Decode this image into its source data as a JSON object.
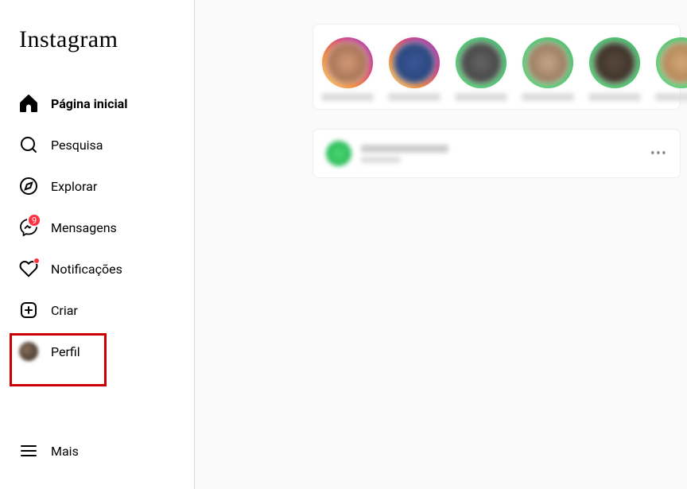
{
  "brand": "Instagram",
  "sidebar": {
    "items": [
      {
        "label": "Página inicial",
        "icon": "home-icon",
        "active": true
      },
      {
        "label": "Pesquisa",
        "icon": "search-icon"
      },
      {
        "label": "Explorar",
        "icon": "compass-icon"
      },
      {
        "label": "Mensagens",
        "icon": "messenger-icon",
        "badge": "9"
      },
      {
        "label": "Notificações",
        "icon": "heart-icon",
        "dot": true
      },
      {
        "label": "Criar",
        "icon": "plus-square-icon",
        "highlighted": true
      },
      {
        "label": "Perfil",
        "icon": "profile-avatar"
      }
    ],
    "more_label": "Mais"
  },
  "stories": {
    "items": [
      {
        "ring_gradient": "linear-gradient(45deg,#feda75,#fa7e1e,#d62976,#962fbf)",
        "bg": "radial-gradient(circle,#d49b7a,#8b5a3c)"
      },
      {
        "ring_gradient": "linear-gradient(45deg,#feda75,#fa7e1e,#d62976,#962fbf)",
        "bg": "radial-gradient(circle,#3b5998,#1e3a6e)"
      },
      {
        "ring_gradient": "linear-gradient(45deg,#4dd471,#2dbd5d)",
        "bg": "radial-gradient(circle,#666,#333)"
      },
      {
        "ring_gradient": "linear-gradient(45deg,#4dd471,#2dbd5d)",
        "bg": "radial-gradient(circle,#c9a888,#7d6148)"
      },
      {
        "ring_gradient": "linear-gradient(45deg,#4dd471,#2dbd5d)",
        "bg": "radial-gradient(circle,#5a4a3d,#2e251e)"
      },
      {
        "ring_gradient": "linear-gradient(45deg,#4dd471,#2dbd5d)",
        "bg": "radial-gradient(circle,#d4a878,#a07548)"
      }
    ]
  },
  "post": {
    "more": "•••"
  }
}
